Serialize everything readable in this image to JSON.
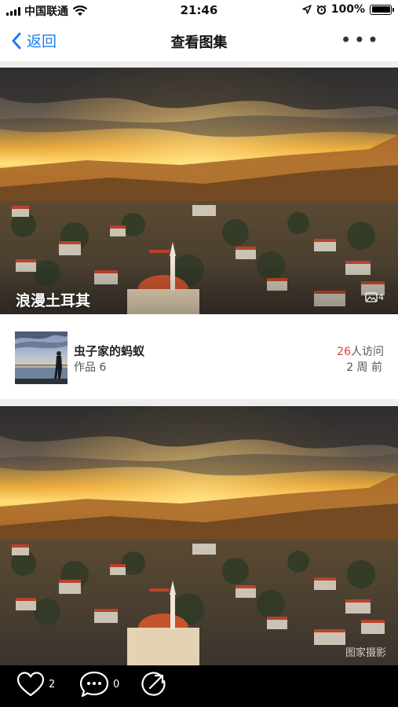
{
  "status_bar": {
    "carrier": "中国联通",
    "time": "21:46",
    "battery": "100%"
  },
  "nav": {
    "back_label": "返回",
    "title": "查看图集",
    "more_label": "•••"
  },
  "album": {
    "title": "浪漫土耳其",
    "photo_count": "4",
    "watermark": "图家摄影"
  },
  "author": {
    "name": "虫子家的蚂蚁",
    "works": "作品 6",
    "visit_count": "26",
    "visit_suffix": "人访问",
    "time_ago": "2 周 前"
  },
  "actions": {
    "likes": "2",
    "comments": "0"
  },
  "colors": {
    "accent": "#1a7cf0",
    "visit_count": "#e53935"
  }
}
